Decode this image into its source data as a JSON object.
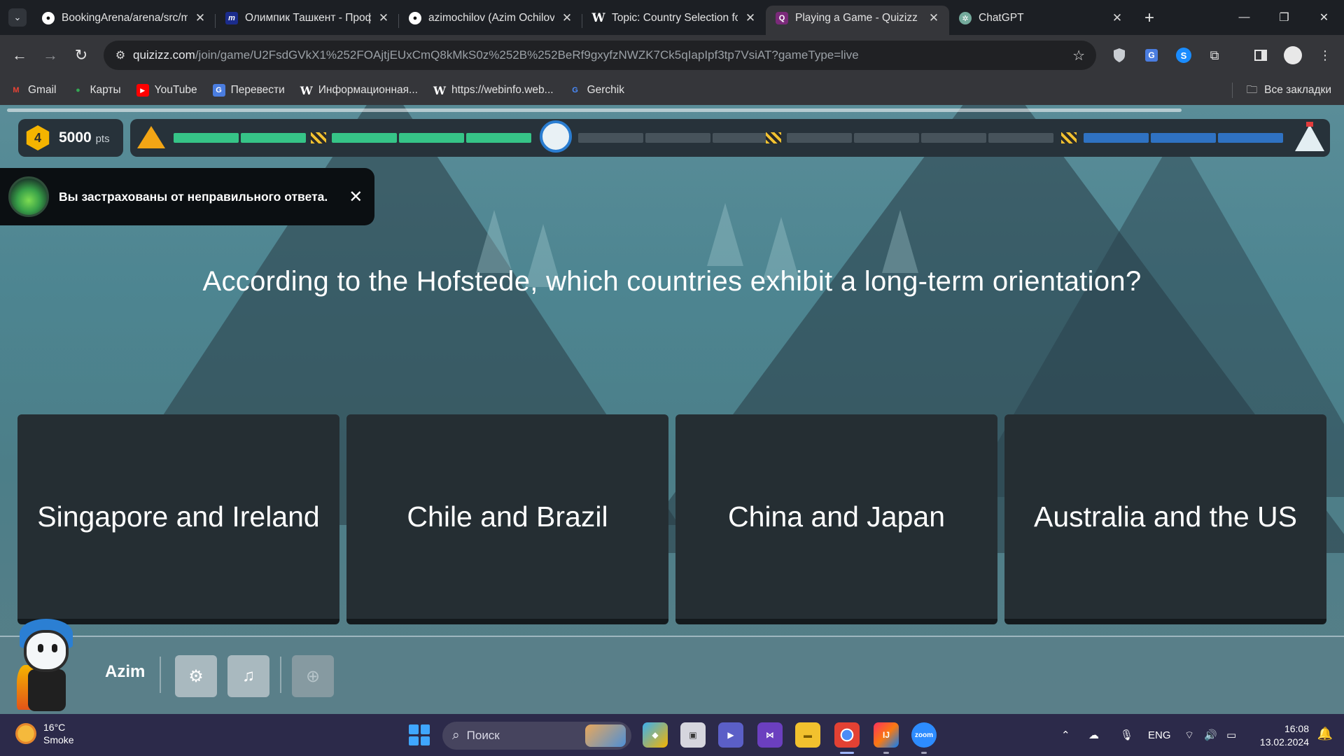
{
  "browser": {
    "tabs": [
      {
        "title": "BookingArena/arena/src/m",
        "favicon": "github-icon",
        "active": false
      },
      {
        "title": "Олимпик Ташкент - Проф",
        "favicon": "om-icon",
        "active": false
      },
      {
        "title": "azimochilov (Azim Ochilov)",
        "favicon": "github-icon",
        "active": false
      },
      {
        "title": "Topic: Country Selection fo",
        "favicon": "wikipedia-icon",
        "active": false
      },
      {
        "title": "Playing a Game - Quizizz",
        "favicon": "quizizz-icon",
        "active": true
      },
      {
        "title": "ChatGPT",
        "favicon": "chatgpt-icon",
        "active": false
      }
    ],
    "address": {
      "host": "quizizz.com",
      "path": "/join/game/U2FsdGVkX1%252FOAjtjEUxCmQ8kMkS0z%252B%252BeRf9gxyfzNWZK7Ck5qIapIpf3tp7VsiAT?gameType=live"
    },
    "bookmarks": [
      {
        "label": "Gmail",
        "icon": "gmail-icon"
      },
      {
        "label": "Карты",
        "icon": "maps-icon"
      },
      {
        "label": "YouTube",
        "icon": "youtube-icon"
      },
      {
        "label": "Перевести",
        "icon": "translate-icon"
      },
      {
        "label": "Информационная...",
        "icon": "wikipedia-icon"
      },
      {
        "label": "https://webinfo.web...",
        "icon": "wikipedia-icon"
      },
      {
        "label": "Gerchik",
        "icon": "gerchik-icon"
      }
    ],
    "all_bookmarks": "Все закладки"
  },
  "game": {
    "streak": "4",
    "points": "5000",
    "points_unit": "pts",
    "progress": {
      "completed_segments": 5,
      "remaining_segments": 9,
      "bonus_segments": 3
    },
    "toast": {
      "message": "Вы застрахованы от неправильного ответа.",
      "close": "✕"
    },
    "question": "According to the Hofstede, which countries exhibit a long-term orientation?",
    "options": [
      "Singapore and Ireland",
      "Chile and Brazil",
      "China and Japan",
      "Australia and the US"
    ],
    "player": {
      "name": "Azim"
    },
    "colors": {
      "done": "#36c487",
      "todo": "#47535b",
      "bonus": "#2f72c2",
      "option_bg": "#252e33"
    }
  },
  "taskbar": {
    "weather": {
      "temp": "16°C",
      "condition": "Smoke"
    },
    "search_placeholder": "Поиск",
    "lang": "ENG",
    "time": "16:08",
    "date": "13.02.2024"
  }
}
